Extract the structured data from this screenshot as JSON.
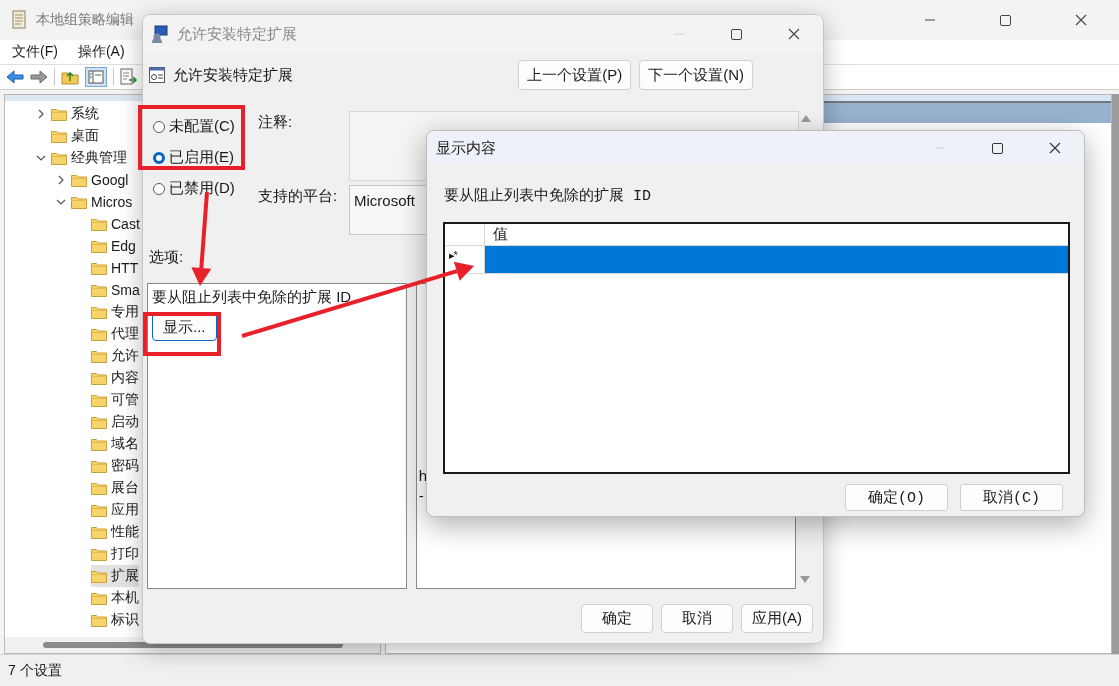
{
  "main_window": {
    "title": "本地组策略编辑",
    "menu": [
      "文件(F)",
      "操作(A)"
    ],
    "tree": [
      {
        "label": "系统",
        "expanded": false,
        "selected": false
      },
      {
        "label": "桌面",
        "selected": false
      },
      {
        "label": "经典管理",
        "expanded": true,
        "selected": false,
        "children": [
          {
            "label": "Googl",
            "expanded": false,
            "selected": false
          },
          {
            "label": "Micros",
            "expanded": true,
            "selected": false,
            "children": [
              {
                "label": "Cast",
                "selected": false
              },
              {
                "label": "Edg",
                "selected": false
              },
              {
                "label": "HTT",
                "selected": false
              },
              {
                "label": "Sma",
                "selected": false
              },
              {
                "label": "专用",
                "selected": false
              },
              {
                "label": "代理",
                "selected": false
              },
              {
                "label": "允许",
                "selected": false
              },
              {
                "label": "内容",
                "selected": false
              },
              {
                "label": "可管",
                "selected": false
              },
              {
                "label": "启动",
                "selected": false
              },
              {
                "label": "域名",
                "selected": false
              },
              {
                "label": "密码",
                "selected": false
              },
              {
                "label": "展台",
                "selected": false
              },
              {
                "label": "应用",
                "selected": false
              },
              {
                "label": "性能",
                "selected": false
              },
              {
                "label": "打印",
                "selected": false
              },
              {
                "label": "扩展",
                "selected": true
              },
              {
                "label": "本机",
                "selected": false
              },
              {
                "label": "标识",
                "selected": false
              }
            ]
          }
        ]
      }
    ],
    "status_bar": "7 个设置"
  },
  "policy_dialog": {
    "title": "允许安装特定扩展",
    "heading": "允许安装特定扩展",
    "nav_buttons": [
      "上一个设置(P)",
      "下一个设置(N)"
    ],
    "state_options": [
      {
        "label": "未配置(C)",
        "selected": false
      },
      {
        "label": "已启用(E)",
        "selected": true
      },
      {
        "label": "已禁用(D)",
        "selected": false
      }
    ],
    "comment_label": "注释:",
    "platform_label": "支持的平台:",
    "platform_value": "Microsoft",
    "options_label": "选项:",
    "option_text": "要从阻止列表中免除的扩展 ID",
    "show_button": "显示...",
    "help_lines": [
      "h",
      "-"
    ],
    "buttons": [
      "确定",
      "取消",
      "应用(A)"
    ]
  },
  "list_dialog": {
    "title": "显示内容",
    "prompt": "要从阻止列表中免除的扩展 ID",
    "column": "值",
    "row_marker": "▸*",
    "rows": [
      {
        "selected": true
      }
    ],
    "buttons": [
      "确定(O)",
      "取消(C)"
    ]
  },
  "annotations": [
    {
      "kind": "frame"
    },
    {
      "kind": "frame"
    },
    {
      "kind": "arrow"
    },
    {
      "kind": "arrow"
    }
  ]
}
